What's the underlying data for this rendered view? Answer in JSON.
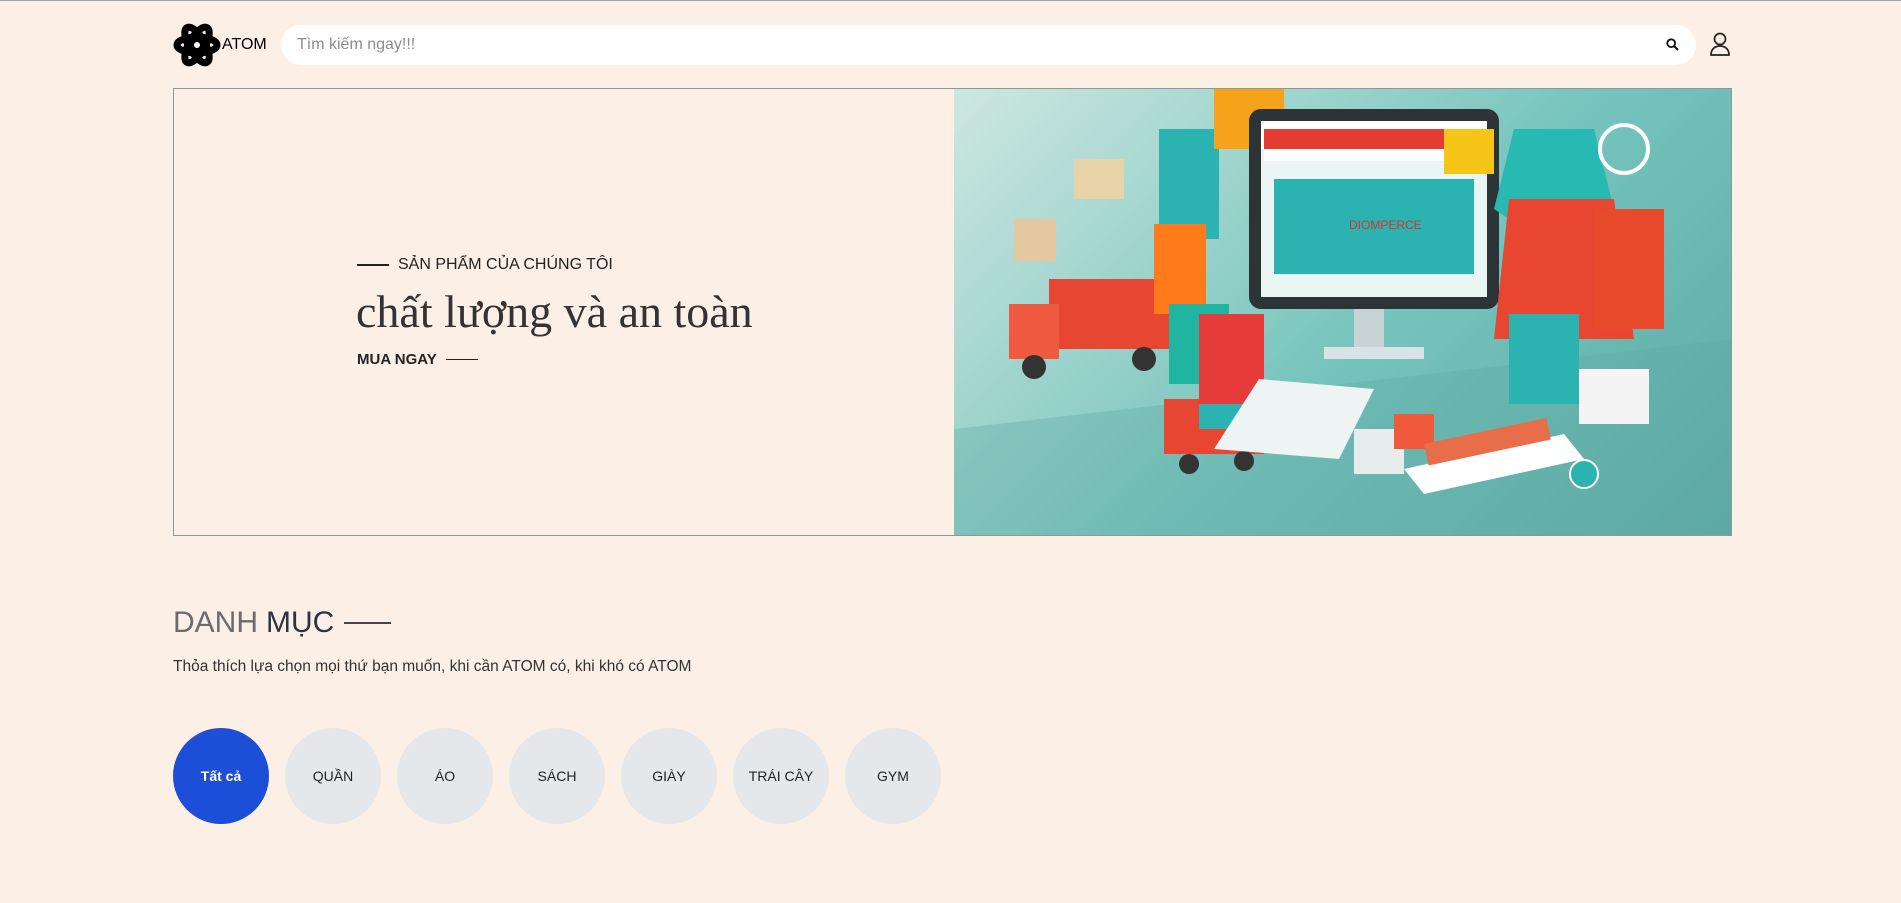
{
  "header": {
    "logo_text": "ATOM",
    "search": {
      "placeholder": "Tìm kiếm ngay!!!",
      "value": ""
    }
  },
  "hero": {
    "eyebrow": "SẢN PHẨM CỦA CHÚNG TÔI",
    "title": "chất lượng và an toàn",
    "cta": "MUA NGAY",
    "image_text": "DIOMPERCE"
  },
  "categories": {
    "title_part1": "DANH",
    "title_part2": "MỤC",
    "subtitle": "Thỏa thích lựa chọn mọi thứ bạn muốn, khi cần ATOM có, khi khó có ATOM",
    "items": [
      {
        "label": "Tất cả",
        "active": true
      },
      {
        "label": "QUẦN"
      },
      {
        "label": "ÁO"
      },
      {
        "label": "SÁCH"
      },
      {
        "label": "GIÀY"
      },
      {
        "label": "TRÁI CÂY"
      },
      {
        "label": "GYM"
      }
    ]
  },
  "colors": {
    "background": "#fcefe6",
    "accent": "#1d4ed8",
    "category_bg": "#e5e7eb"
  }
}
